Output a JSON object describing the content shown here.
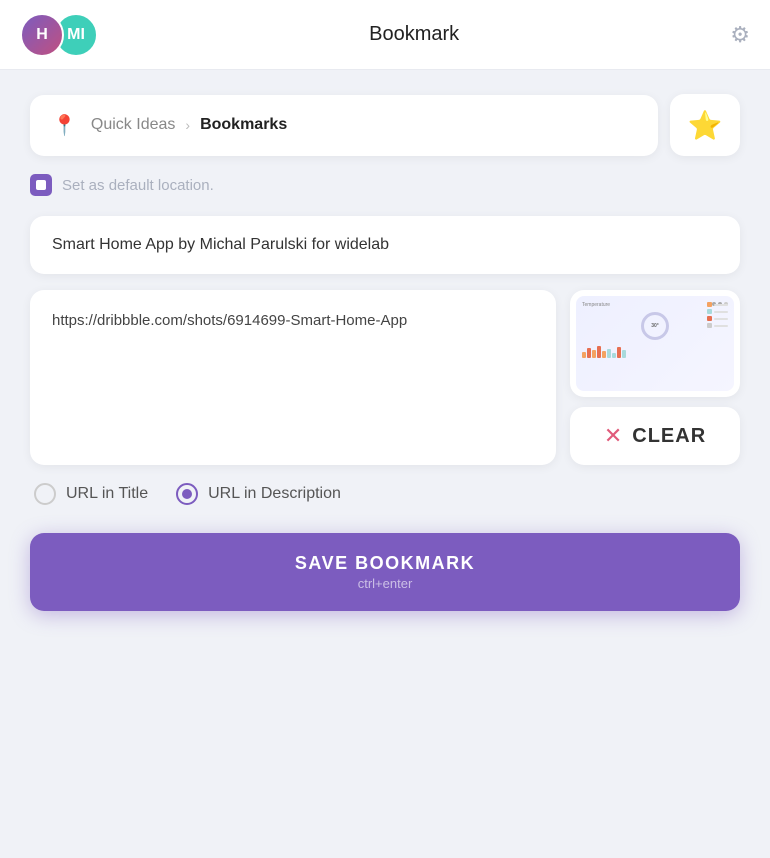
{
  "header": {
    "title": "Bookmark",
    "avatar_h_label": "H",
    "avatar_mi_label": "MI"
  },
  "location": {
    "quick_ideas_label": "Quick Ideas",
    "bookmarks_label": "Bookmarks",
    "chevron": "›"
  },
  "checkbox": {
    "label": "Set as default location."
  },
  "title_card": {
    "text": "Smart Home App by Michal Parulski for widelab"
  },
  "url_card": {
    "text": "https://dribbble.com/shots/6914699-Smart-Home-App"
  },
  "clear_button": {
    "label": "CLEAR"
  },
  "radio_options": {
    "url_title_label": "URL in Title",
    "url_description_label": "URL in Description"
  },
  "save_button": {
    "label": "SAVE BOOKMARK",
    "shortcut": "ctrl+enter"
  }
}
